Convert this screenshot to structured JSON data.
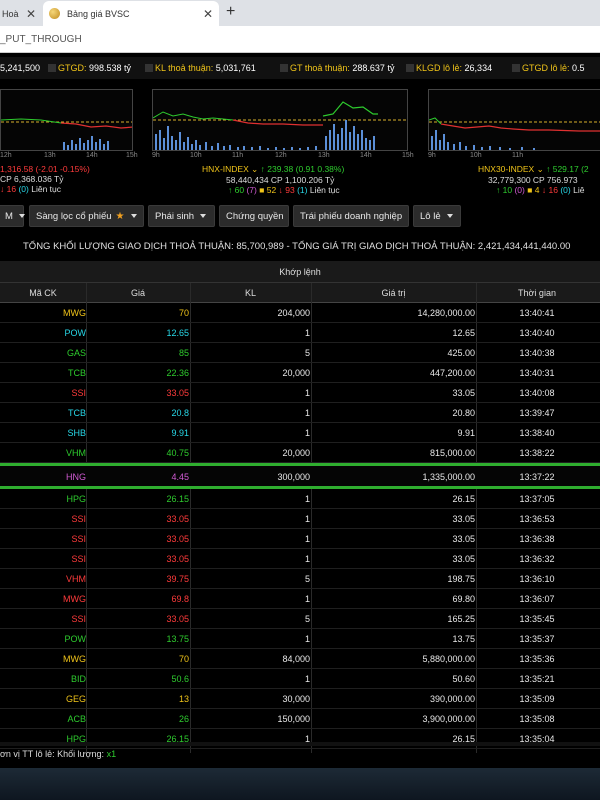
{
  "browser": {
    "tab1_label": "Hoà",
    "tab2_label": "Bảng giá BVSC",
    "address": "_PUT_THROUGH"
  },
  "summary": {
    "vol_partial": "5,241,500",
    "gtgd_label": "GTGD:",
    "gtgd_value": "998.538 tỷ",
    "kl_label": "KL thoả thuận:",
    "kl_value": "5,031,761",
    "gt_label": "GT thoả thuận:",
    "gt_value": "288.637 tỷ",
    "klgd_label": "KLGD lô lẻ:",
    "klgd_value": "26,334",
    "gtgd2_label": "GTGD lô lẻ:",
    "gtgd2_value": "0.5"
  },
  "indices": [
    {
      "name": "",
      "change_line": "1,316.58 (-2.01 -0.15%)",
      "value_line": "CP 6,368.036 Tỷ",
      "stat_up": "",
      "stat_ref": "",
      "stat_down": "16",
      "stat_ceil": "(0)",
      "stat_label": "Liên tục",
      "ticks": [
        "12h",
        "13h",
        "14h",
        "15h"
      ]
    },
    {
      "name": "HNX-INDEX",
      "change_line": "239.38 (0.91 0.38%)",
      "value_line": "58,440,434 CP 1,100.206 Tỷ",
      "stat_up": "60",
      "stat_up_ceil": "(7)",
      "stat_ref": "52",
      "stat_down": "93",
      "stat_ceil": "(1)",
      "stat_label": "Liên tục",
      "ticks": [
        "9h",
        "10h",
        "11h",
        "12h",
        "13h",
        "14h",
        "15h"
      ]
    },
    {
      "name": "HNX30-INDEX",
      "change_line": "529.17 (2",
      "value_line": "32,779,300 CP 756.973",
      "stat_up": "10",
      "stat_up_ceil": "(0)",
      "stat_ref": "4",
      "stat_down": "16",
      "stat_ceil": "(0)",
      "stat_label": "Liê",
      "ticks": [
        "9h",
        "10h",
        "11h"
      ]
    }
  ],
  "filters": {
    "btn1": "M",
    "btn2": "Sàng lọc cổ phiếu",
    "btn3": "Phái sinh",
    "btn4": "Chứng quyền",
    "btn5": "Trái phiếu doanh nghiệp",
    "btn6": "Lô lẻ"
  },
  "totals_text": "TỔNG KHỐI LƯỢNG GIAO DỊCH THOẢ THUẬN: 85,700,989  -  TỔNG GIÁ TRỊ GIAO DỊCH THOẢ THUẬN: 2,421,434,441,440.00",
  "table": {
    "group_header": "Khớp lệnh",
    "columns": [
      "Mã CK",
      "Giá",
      "KL",
      "Giá trị",
      "Thời gian"
    ],
    "rows": [
      {
        "sym": "MWG",
        "price": "70",
        "vol": "204,000",
        "val": "14,280,000.00",
        "time": "13:40:41",
        "color": "#f0c419"
      },
      {
        "sym": "POW",
        "price": "12.65",
        "vol": "1",
        "val": "12.65",
        "time": "13:40:40",
        "color": "#28d8e8"
      },
      {
        "sym": "GAS",
        "price": "85",
        "vol": "5",
        "val": "425.00",
        "time": "13:40:38",
        "color": "#2ecc2e"
      },
      {
        "sym": "TCB",
        "price": "22.36",
        "vol": "20,000",
        "val": "447,200.00",
        "time": "13:40:31",
        "color": "#2ecc2e"
      },
      {
        "sym": "SSI",
        "price": "33.05",
        "vol": "1",
        "val": "33.05",
        "time": "13:40:08",
        "color": "#ff3b3b"
      },
      {
        "sym": "TCB",
        "price": "20.8",
        "vol": "1",
        "val": "20.80",
        "time": "13:39:47",
        "color": "#28d8e8"
      },
      {
        "sym": "SHB",
        "price": "9.91",
        "vol": "1",
        "val": "9.91",
        "time": "13:38:40",
        "color": "#28d8e8"
      },
      {
        "sym": "VHM",
        "price": "40.75",
        "vol": "20,000",
        "val": "815,000.00",
        "time": "13:38:22",
        "color": "#2ecc2e"
      },
      {
        "sym": "HNG",
        "price": "4.45",
        "vol": "300,000",
        "val": "1,335,000.00",
        "time": "13:37:22",
        "color": "#d25bd4"
      },
      {
        "sym": "HPG",
        "price": "26.15",
        "vol": "1",
        "val": "26.15",
        "time": "13:37:05",
        "color": "#2ecc2e"
      },
      {
        "sym": "SSI",
        "price": "33.05",
        "vol": "1",
        "val": "33.05",
        "time": "13:36:53",
        "color": "#ff3b3b"
      },
      {
        "sym": "SSI",
        "price": "33.05",
        "vol": "1",
        "val": "33.05",
        "time": "13:36:38",
        "color": "#ff3b3b"
      },
      {
        "sym": "SSI",
        "price": "33.05",
        "vol": "1",
        "val": "33.05",
        "time": "13:36:32",
        "color": "#ff3b3b"
      },
      {
        "sym": "VHM",
        "price": "39.75",
        "vol": "5",
        "val": "198.75",
        "time": "13:36:10",
        "color": "#ff3b3b"
      },
      {
        "sym": "MWG",
        "price": "69.8",
        "vol": "1",
        "val": "69.80",
        "time": "13:36:07",
        "color": "#ff3b3b"
      },
      {
        "sym": "SSI",
        "price": "33.05",
        "vol": "5",
        "val": "165.25",
        "time": "13:35:45",
        "color": "#ff3b3b"
      },
      {
        "sym": "POW",
        "price": "13.75",
        "vol": "1",
        "val": "13.75",
        "time": "13:35:37",
        "color": "#2ecc2e"
      },
      {
        "sym": "MWG",
        "price": "70",
        "vol": "84,000",
        "val": "5,880,000.00",
        "time": "13:35:36",
        "color": "#f0c419"
      },
      {
        "sym": "BID",
        "price": "50.6",
        "vol": "1",
        "val": "50.60",
        "time": "13:35:21",
        "color": "#2ecc2e"
      },
      {
        "sym": "GEG",
        "price": "13",
        "vol": "30,000",
        "val": "390,000.00",
        "time": "13:35:09",
        "color": "#f0c419"
      },
      {
        "sym": "ACB",
        "price": "26",
        "vol": "150,000",
        "val": "3,900,000.00",
        "time": "13:35:08",
        "color": "#2ecc2e"
      },
      {
        "sym": "HPG",
        "price": "26.15",
        "vol": "1",
        "val": "26.15",
        "time": "13:35:04",
        "color": "#2ecc2e"
      }
    ]
  },
  "footer": {
    "label": "ơn vị TT lô lẻ: Khối lượng:",
    "multiplier": "x1"
  }
}
